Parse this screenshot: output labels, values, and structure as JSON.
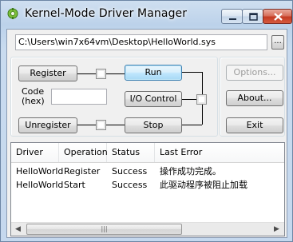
{
  "window": {
    "title": "Kernel-Mode Driver Manager",
    "icon": "app-gear-icon"
  },
  "path": {
    "value": "C:\\Users\\win7x64vm\\Desktop\\HelloWorld.sys",
    "browse_label": "..."
  },
  "controls": {
    "register_label": "Register",
    "run_label": "Run",
    "code_label": "Code\n(hex)",
    "io_control_label": "I/O Control",
    "unregister_label": "Unregister",
    "stop_label": "Stop",
    "code_value": ""
  },
  "side_buttons": {
    "options_label": "Options...",
    "about_label": "About...",
    "exit_label": "Exit"
  },
  "log": {
    "columns": [
      "Driver",
      "Operation",
      "Status",
      "Last Error"
    ],
    "rows": [
      {
        "driver": "HelloWorld",
        "operation": "Register",
        "status": "Success",
        "last_error": "操作成功完成。"
      },
      {
        "driver": "HelloWorld",
        "operation": "Start",
        "status": "Success",
        "last_error": "此驱动程序被阻止加载"
      }
    ]
  },
  "scrollbar": {
    "left_arrow": "◀",
    "right_arrow": "▶",
    "grip": "|||"
  }
}
